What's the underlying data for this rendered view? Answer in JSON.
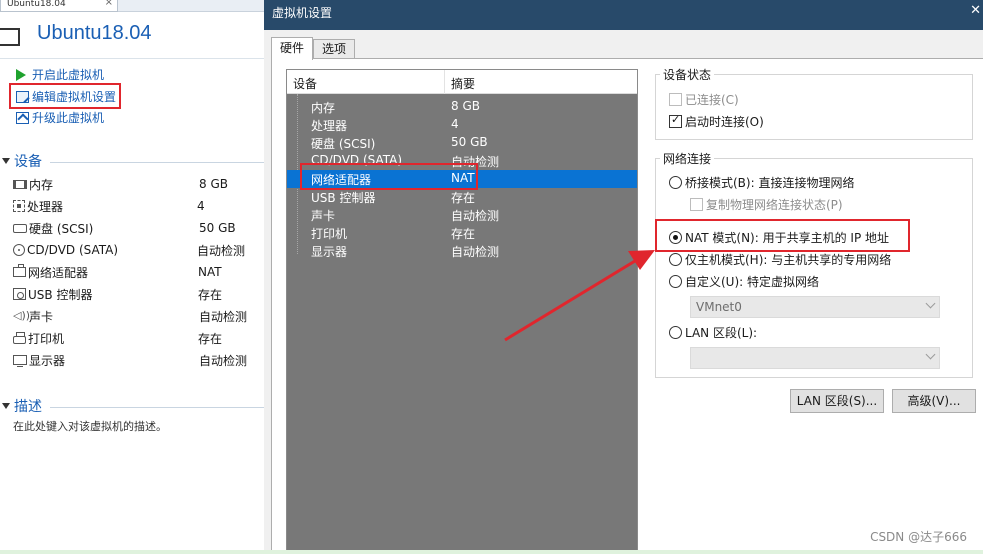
{
  "left_pane": {
    "tab_label": "Ubuntu18.04",
    "vm_title": "Ubuntu18.04",
    "actions": {
      "power_on": "开启此虚拟机",
      "edit_settings": "编辑虚拟机设置",
      "upgrade": "升级此虚拟机"
    },
    "devices_header": "设备",
    "devices": [
      {
        "icon": "memory-icon",
        "name": "内存",
        "value": "8 GB"
      },
      {
        "icon": "processor-icon",
        "name": "处理器",
        "value": "4"
      },
      {
        "icon": "hard-disk-icon",
        "name": "硬盘 (SCSI)",
        "value": "50 GB"
      },
      {
        "icon": "cd-dvd-icon",
        "name": "CD/DVD (SATA)",
        "value": "自动检测"
      },
      {
        "icon": "network-adapter-icon",
        "name": "网络适配器",
        "value": "NAT"
      },
      {
        "icon": "usb-controller-icon",
        "name": "USB 控制器",
        "value": "存在"
      },
      {
        "icon": "sound-card-icon",
        "name": "声卡",
        "value": "自动检测"
      },
      {
        "icon": "printer-icon",
        "name": "打印机",
        "value": "存在"
      },
      {
        "icon": "display-icon",
        "name": "显示器",
        "value": "自动检测"
      }
    ],
    "description_header": "描述",
    "description_text": "在此处键入对该虚拟机的描述。"
  },
  "dialog": {
    "title": "虚拟机设置",
    "tabs": [
      "硬件",
      "选项"
    ],
    "device_list": {
      "col_device": "设备",
      "col_summary": "摘要",
      "rows": [
        {
          "name": "内存",
          "summary": "8 GB"
        },
        {
          "name": "处理器",
          "summary": "4"
        },
        {
          "name": "硬盘 (SCSI)",
          "summary": "50 GB"
        },
        {
          "name": "CD/DVD (SATA)",
          "summary": "自动检测"
        },
        {
          "name": "网络适配器",
          "summary": "NAT",
          "selected": true
        },
        {
          "name": "USB 控制器",
          "summary": "存在"
        },
        {
          "name": "声卡",
          "summary": "自动检测"
        },
        {
          "name": "打印机",
          "summary": "存在"
        },
        {
          "name": "显示器",
          "summary": "自动检测"
        }
      ]
    },
    "device_status": {
      "legend": "设备状态",
      "connected": "已连接(C)",
      "connect_at_power_on": "启动时连接(O)"
    },
    "network_connection": {
      "legend": "网络连接",
      "bridged": "桥接模式(B): 直接连接物理网络",
      "replicate_state": "复制物理网络连接状态(P)",
      "nat": "NAT 模式(N): 用于共享主机的 IP 地址",
      "host_only": "仅主机模式(H): 与主机共享的专用网络",
      "custom": "自定义(U): 特定虚拟网络",
      "custom_value": "VMnet0",
      "lan_segment": "LAN 区段(L):",
      "lan_value": ""
    },
    "buttons": {
      "lan_segments": "LAN 区段(S)...",
      "advanced": "高级(V)..."
    }
  },
  "watermark": "CSDN @达子666",
  "colors": {
    "highlight": "#e0262d",
    "selection": "#0a73d3",
    "titlebar": "#284a6a",
    "link": "#1a5fb4"
  }
}
